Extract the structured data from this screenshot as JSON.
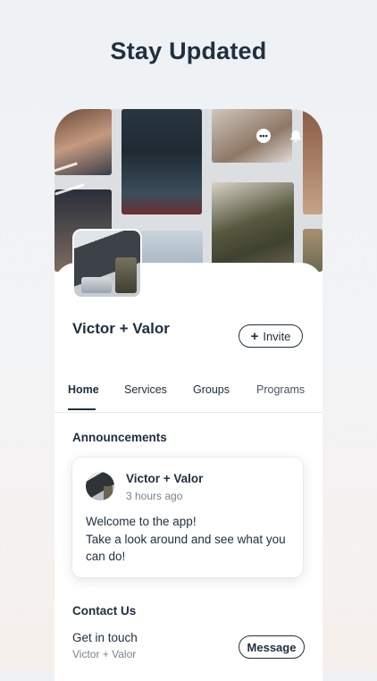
{
  "headline": "Stay Updated",
  "cover": {
    "chat_icon": "chat-bubble-icon",
    "bell_icon": "bell-icon"
  },
  "org": {
    "name": "Victor + Valor",
    "invite_label": "Invite"
  },
  "tabs": [
    {
      "label": "Home",
      "active": true
    },
    {
      "label": "Services",
      "active": false
    },
    {
      "label": "Groups",
      "active": false
    },
    {
      "label": "Programs",
      "active": false
    }
  ],
  "announcements": {
    "title": "Announcements",
    "post": {
      "author": "Victor + Valor",
      "time": "3 hours ago",
      "body_lines": [
        "Welcome to the app!",
        "Take a look around and see what you can do!"
      ]
    }
  },
  "contact": {
    "title": "Contact Us",
    "line": "Get in touch",
    "sub": "Victor + Valor",
    "message_label": "Message"
  }
}
